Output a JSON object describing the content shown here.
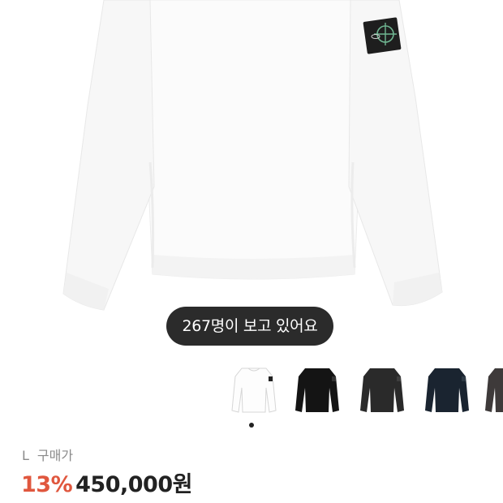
{
  "viewers_toast": "267명이 보고 있어요",
  "thumbnails": [
    {
      "name": "thumb-white-sweatshirt",
      "color": "#ffffff",
      "selected": true
    },
    {
      "name": "thumb-black-sweatshirt",
      "color": "#141414",
      "selected": false
    },
    {
      "name": "thumb-charcoal-sweatshirt",
      "color": "#2a2a2a",
      "selected": false
    },
    {
      "name": "thumb-navy-sweatshirt",
      "color": "#1a2430",
      "selected": false
    },
    {
      "name": "thumb-grey-sweatshirt",
      "color": "#3e3a3a",
      "selected": false
    }
  ],
  "size": {
    "value": "L",
    "label": "구매가"
  },
  "price": {
    "discount": "13%",
    "amount": "450,000원"
  },
  "colors": {
    "discount": "#e0573e",
    "toast_bg": "#2b2b2b"
  }
}
